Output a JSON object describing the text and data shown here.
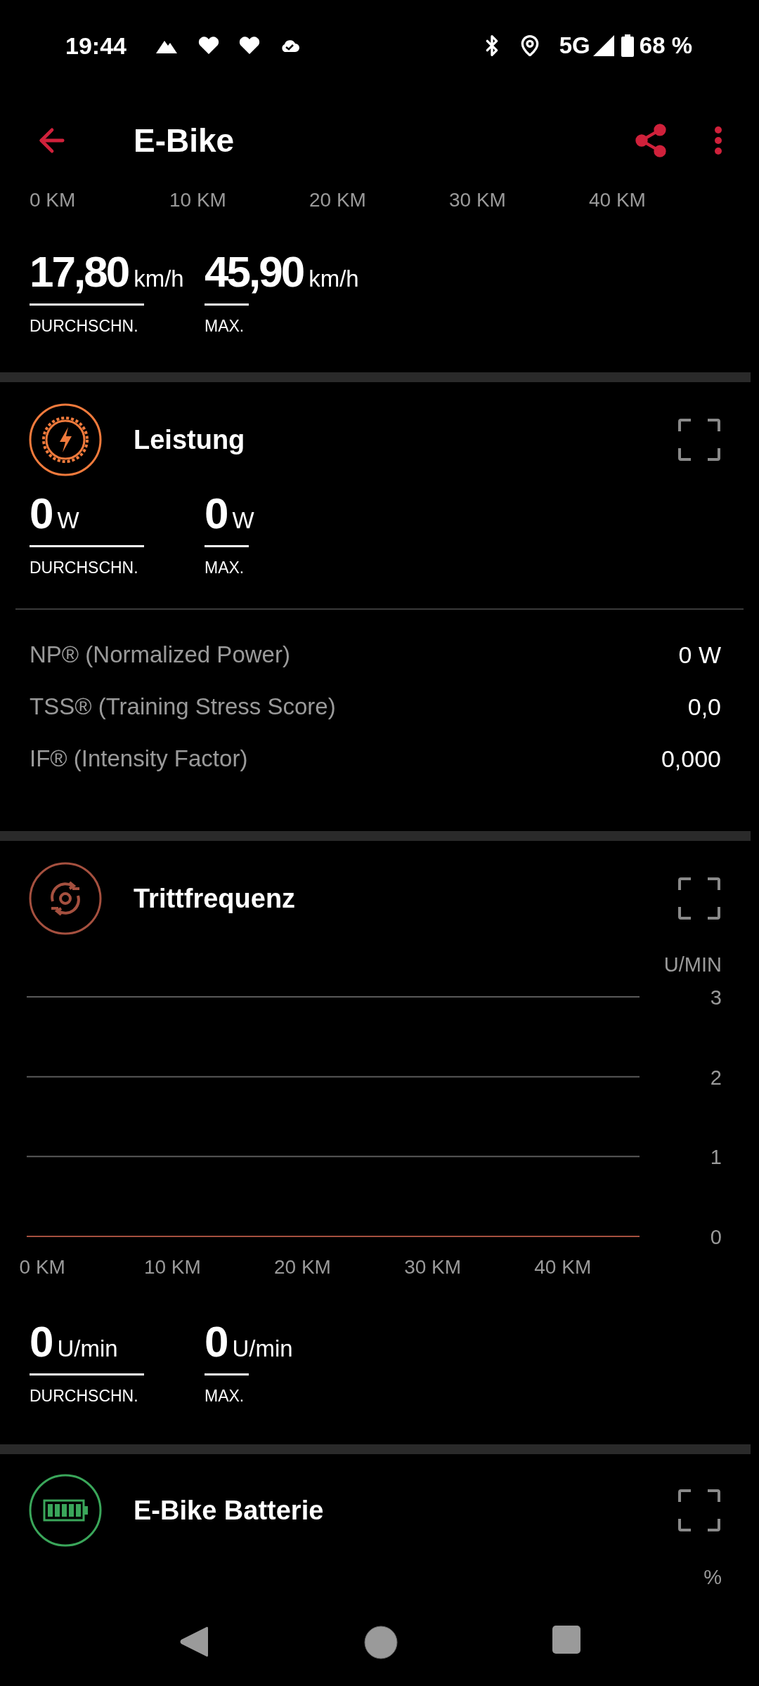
{
  "status_bar": {
    "time": "19:44",
    "network": "5G",
    "battery": "68 %"
  },
  "app_bar": {
    "title": "E-Bike"
  },
  "speed": {
    "axis_labels": [
      "0 KM",
      "10 KM",
      "20 KM",
      "30 KM",
      "40 KM"
    ],
    "stats": [
      {
        "value": "17,80",
        "unit": "km/h",
        "label": "DURCHSCHN."
      },
      {
        "value": "45,90",
        "unit": "km/h",
        "label": "MAX."
      }
    ]
  },
  "sections": [
    {
      "kind": "power",
      "title": "Leistung",
      "stats": [
        {
          "value": "0",
          "unit": "W",
          "label": "DURCHSCHN."
        },
        {
          "value": "0",
          "unit": "W",
          "label": "MAX."
        }
      ],
      "metrics": [
        {
          "label": "NP® (Normalized Power)",
          "value": "0 W"
        },
        {
          "label": "TSS® (Training Stress Score)",
          "value": "0,0"
        },
        {
          "label": "IF® (Intensity Factor)",
          "value": "0,000"
        }
      ]
    },
    {
      "kind": "cadence",
      "title": "Trittfrequenz",
      "chart_data": {
        "type": "line",
        "ylabel": "U/MIN",
        "xlim": [
          -1.2,
          45.9
        ],
        "ylim": [
          0,
          3
        ],
        "yticks": [
          0,
          1,
          2,
          3
        ],
        "xticks": [
          {
            "value": 0,
            "label": "0 KM"
          },
          {
            "value": 10,
            "label": "10 KM"
          },
          {
            "value": 20,
            "label": "20 KM"
          },
          {
            "value": 30,
            "label": "30 KM"
          },
          {
            "value": 40,
            "label": "40 KM"
          }
        ]
      },
      "stats": [
        {
          "value": "0",
          "unit": "U/min",
          "label": "DURCHSCHN."
        },
        {
          "value": "0",
          "unit": "U/min",
          "label": "MAX."
        }
      ]
    },
    {
      "kind": "battery",
      "title": "E-Bike Batterie",
      "unit_label": "%"
    }
  ]
}
